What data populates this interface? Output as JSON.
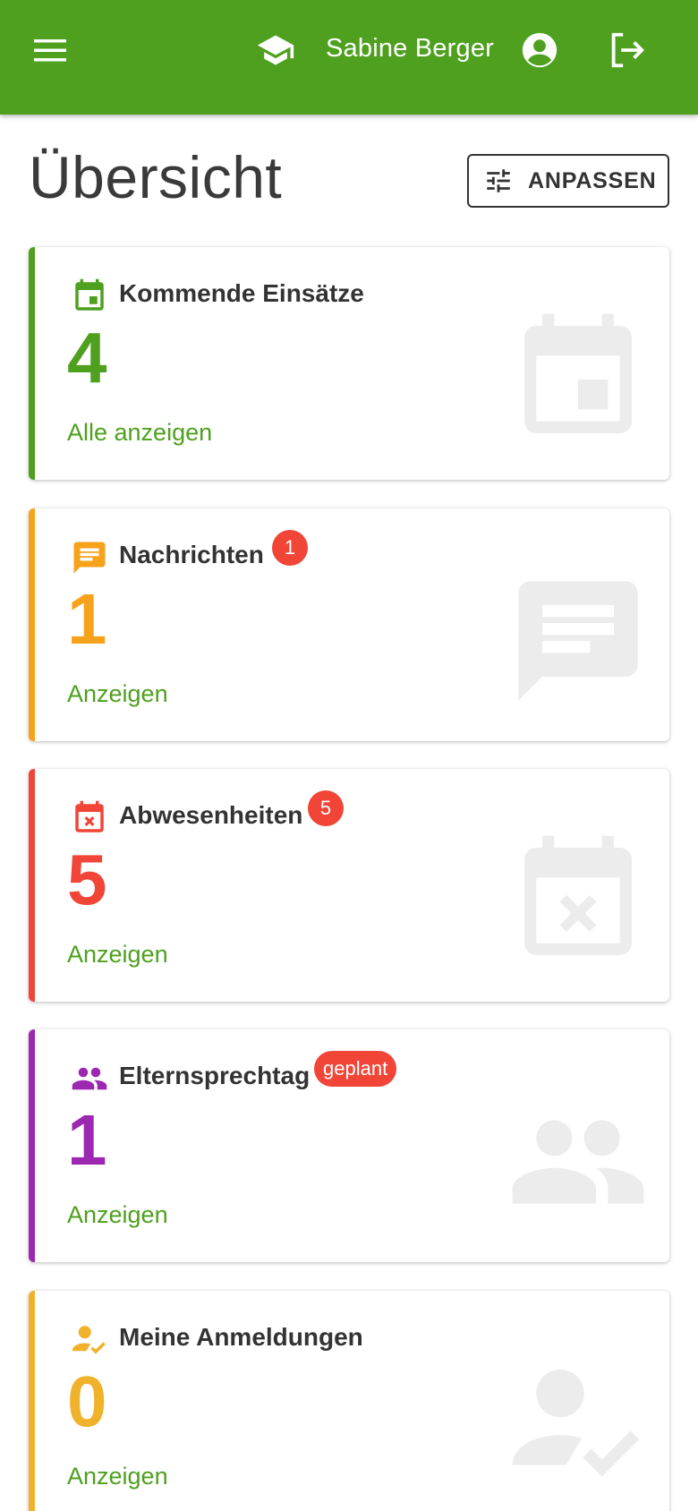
{
  "header": {
    "user_name": "Sabine Berger",
    "menu_icon": "menu-icon",
    "school_icon": "school-icon",
    "account_icon": "account-circle-icon",
    "logout_icon": "logout-icon",
    "background_color": "#4ea01e"
  },
  "page": {
    "title": "Übersicht",
    "customize_label": "ANPASSEN",
    "customize_icon": "tune-icon"
  },
  "cards": [
    {
      "title": "Kommende Einsätze",
      "count": "4",
      "link": "Alle anzeigen",
      "badge": "",
      "color": "#4ea01e",
      "icon": "calendar-event-icon"
    },
    {
      "title": "Nachrichten",
      "count": "1",
      "link": "Anzeigen",
      "badge": "1",
      "color": "#f7a21b",
      "icon": "message-icon"
    },
    {
      "title": "Abwesenheiten",
      "count": "5",
      "link": "Anzeigen",
      "badge": "5",
      "color": "#f04537",
      "icon": "calendar-remove-icon"
    },
    {
      "title": "Elternsprechtag",
      "count": "1",
      "link": "Anzeigen",
      "badge": "geplant",
      "color": "#9c27b0",
      "icon": "people-icon"
    },
    {
      "title": "Meine Anmeldungen",
      "count": "0",
      "link": "Anzeigen",
      "badge": "",
      "color": "#f0b22a",
      "icon": "person-check-icon"
    }
  ],
  "colors": {
    "link": "#4ea01e",
    "badge": "#f04537",
    "background_icon": "#ececec"
  }
}
